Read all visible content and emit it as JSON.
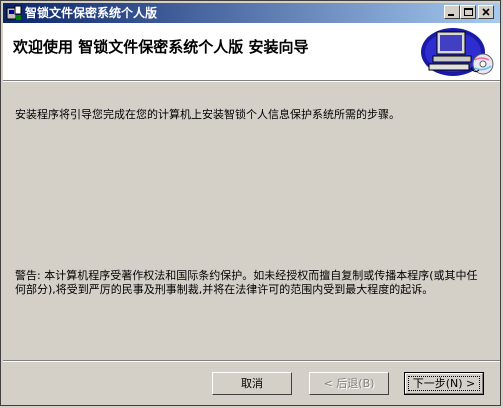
{
  "window": {
    "title": "智锁文件保密系统个人版",
    "icon": "installer-app-icon",
    "controls": [
      "minimize-icon",
      "maximize-icon",
      "close-icon"
    ]
  },
  "header": {
    "title": "欢迎使用 智锁文件保密系统个人版 安装向导",
    "graphic": "computer-with-cd-icon"
  },
  "content": {
    "intro": "安装程序将引导您完成在您的计算机上安装智锁个人信息保护系统所需的步骤。",
    "warning": "警告: 本计算机程序受著作权法和国际条约保护。如未经授权而擅自复制或传播本程序(或其中任何部分),将受到严厉的民事及刑事制裁,并将在法律许可的范围内受到最大程度的起诉。"
  },
  "buttons": {
    "cancel": "取消",
    "back": "< 后退(B)",
    "next": "下一步(N) >"
  },
  "colors": {
    "title_gradient_start": "#0a246a",
    "title_gradient_end": "#a6caf0",
    "face": "#d4d0c8"
  }
}
